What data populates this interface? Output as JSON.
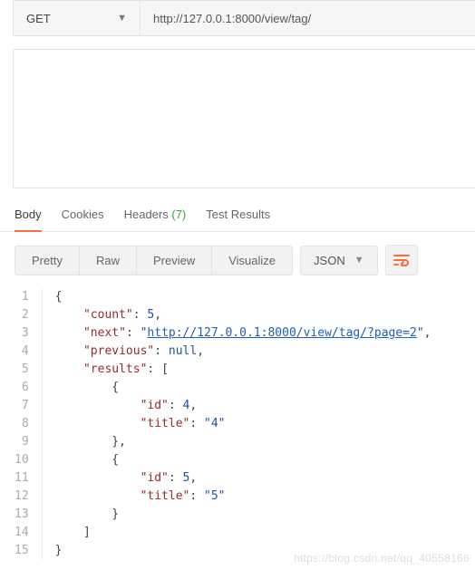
{
  "request": {
    "method": "GET",
    "url": "http://127.0.0.1:8000/view/tag/"
  },
  "response_tabs": {
    "body": "Body",
    "cookies": "Cookies",
    "headers": "Headers",
    "headers_count": "(7)",
    "test_results": "Test Results"
  },
  "view_modes": {
    "pretty": "Pretty",
    "raw": "Raw",
    "preview": "Preview",
    "visualize": "Visualize"
  },
  "format": {
    "selected": "JSON"
  },
  "json_body": {
    "count": 5,
    "next": "http://127.0.0.1:8000/view/tag/?page=2",
    "previous": null,
    "results": [
      {
        "id": 4,
        "title": "4"
      },
      {
        "id": 5,
        "title": "5"
      }
    ]
  },
  "watermark": "https://blog.csdn.net/qq_40558166"
}
